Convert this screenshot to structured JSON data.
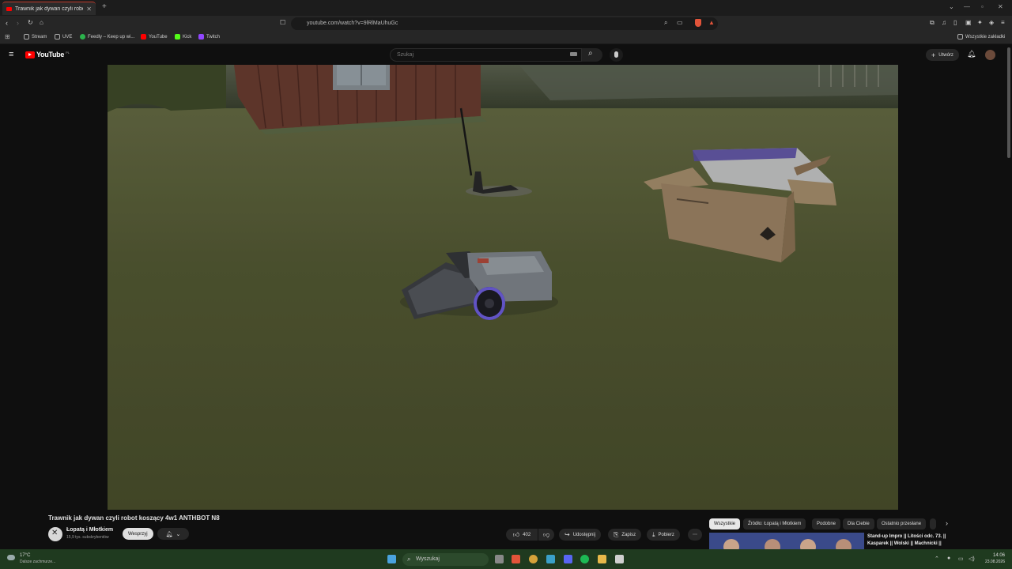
{
  "browser": {
    "tab_title": "Trawnik jak dywan czyli robot",
    "url": "youtube.com/watch?v=9lRlMaUhuGc",
    "bookmarks": [
      {
        "label": "Stream",
        "color": "#888888"
      },
      {
        "label": "UVE",
        "color": "#888888"
      },
      {
        "label": "Feedly – Keep up wi...",
        "color": "#2bb24c"
      },
      {
        "label": "YouTube",
        "color": "#ff0000"
      },
      {
        "label": "Kick",
        "color": "#53fc18"
      },
      {
        "label": "Twitch",
        "color": "#9146ff"
      }
    ],
    "all_bookmarks": "Wszystkie zakładki"
  },
  "youtube": {
    "logo_text": "YouTube",
    "region": "PL",
    "search_placeholder": "Szukaj",
    "create_label": "Utwórz"
  },
  "video": {
    "title": "Trawnik jak dywan czyli robot koszący 4w1 ANTHBOT N8",
    "channel": "Łopatą i Młotkiem",
    "subscribers": "15,9 tys. subskrybentów",
    "support_label": "Wesprzyj",
    "likes": "402",
    "share_label": "Udostępnij",
    "save_label": "Zapisz",
    "download_label": "Pobierz"
  },
  "chips": [
    "Wszystkie",
    "Źródło: Łopatą i Młotkiem",
    "Podobne",
    "Dla Ciebie",
    "Ostatnio przesłane"
  ],
  "recommended": {
    "title": "Stand-up Impro || Litości odc. 73. || Kasparek || Wolski || Machnicki ||"
  },
  "taskbar": {
    "weather_temp": "17°C",
    "weather_desc": "Dalsze zachmurze...",
    "search_label": "Wyszukaj",
    "time": "14:06",
    "date": "23.08.2026"
  }
}
